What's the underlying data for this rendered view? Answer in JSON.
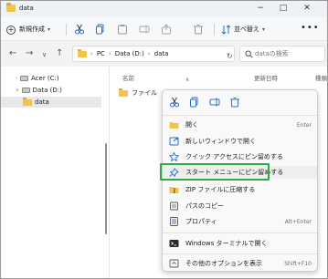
{
  "window": {
    "title": "data",
    "controls": [
      "−",
      "□",
      "✕"
    ]
  },
  "command_bar": {
    "new_label": "新規作成",
    "sort_label": "並べ替え",
    "more": "•••"
  },
  "address_bar": {
    "crumbs": [
      "PC",
      "Data (D:)",
      "data"
    ],
    "search_placeholder": "dataの検索"
  },
  "sidebar": {
    "items": [
      {
        "label": "Acer (C:)",
        "icon": "drive-icon"
      },
      {
        "label": "Data (D:)",
        "icon": "drive-icon"
      },
      {
        "label": "data",
        "icon": "folder-icon",
        "selected": true
      }
    ]
  },
  "content": {
    "columns": [
      "名前",
      "更新日時",
      "種類"
    ],
    "files": [
      {
        "label": "ファイル",
        "icon": "folder-icon"
      }
    ]
  },
  "context_menu": {
    "top_icons": [
      "cut-icon",
      "copy-icon",
      "rename-icon",
      "delete-icon"
    ],
    "items": [
      {
        "label": "開く",
        "shortcut": "Enter",
        "icon": "open-folder-icon"
      },
      {
        "label": "新しいウィンドウで開く",
        "shortcut": "",
        "icon": "new-window-icon"
      },
      {
        "label": "クイック アクセスにピン留めする",
        "shortcut": "",
        "icon": "star-icon"
      },
      {
        "label": "スタート メニューにピン留めする",
        "shortcut": "",
        "icon": "pin-icon",
        "highlighted": true
      },
      {
        "label": "ZIP ファイルに圧縮する",
        "shortcut": "",
        "icon": "zip-icon"
      },
      {
        "label": "パスのコピー",
        "shortcut": "",
        "icon": "copy-path-icon"
      },
      {
        "label": "プロパティ",
        "shortcut": "Alt+Enter",
        "icon": "properties-icon"
      },
      {
        "label": "Windows ターミナルで開く",
        "shortcut": "",
        "icon": "terminal-icon"
      },
      {
        "label": "その他のオプションを表示",
        "shortcut": "Shift+F10",
        "icon": "more-options-icon"
      }
    ]
  },
  "colors": {
    "highlight_border": "#2faa45",
    "folder": "#f3c44a",
    "accent": "#1a73c9"
  }
}
